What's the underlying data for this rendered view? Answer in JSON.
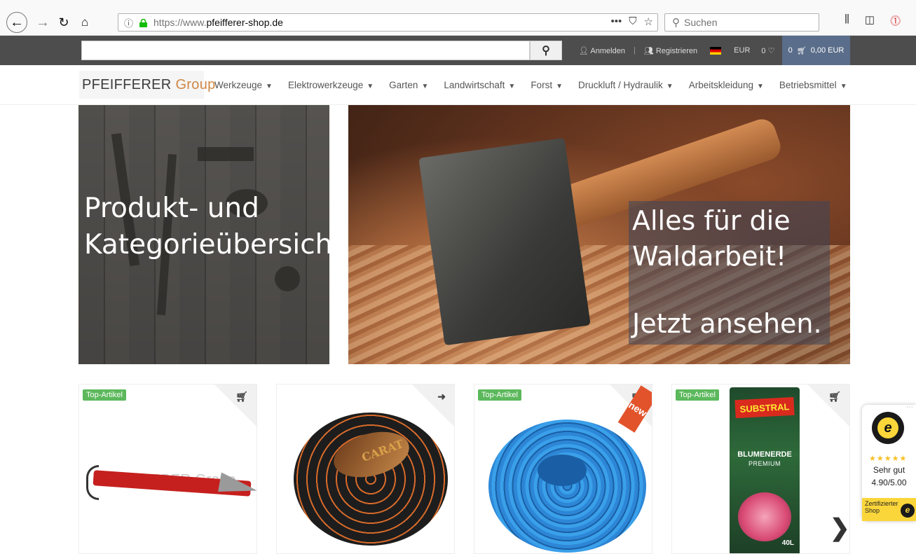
{
  "browser": {
    "url_prefix": "https://www.",
    "url_host": "pfeifferer-shop.de",
    "search_placeholder": "Suchen",
    "url_more": "•••"
  },
  "topbar": {
    "login": "Anmelden",
    "separator": "|",
    "register": "Registrieren",
    "currency": "EUR",
    "wishlist_count": "0",
    "cart_count": "0",
    "cart_total": "0,00 EUR"
  },
  "logo": {
    "part1": "PFEIFFERER",
    "part2": "Group"
  },
  "menu": [
    {
      "label": "Werkzeuge"
    },
    {
      "label": "Elektrowerkzeuge"
    },
    {
      "label": "Garten"
    },
    {
      "label": "Landwirtschaft"
    },
    {
      "label": "Forst"
    },
    {
      "label": "Druckluft / Hydraulik"
    },
    {
      "label": "Arbeitskleidung"
    },
    {
      "label": "Betriebsmittel"
    }
  ],
  "hero": {
    "left_line1": "Produkt- und",
    "left_line2": "Kategorieübersicht",
    "right_line1": "Alles für die",
    "right_line2": "Waldarbeit!",
    "right_cta": "Jetzt ansehen."
  },
  "products": [
    {
      "badge": "Top-Artikel",
      "action_icon": "cart-icon",
      "watermark": "PFEIFFERER Group"
    },
    {
      "badge": "",
      "action_icon": "arrow-right-icon",
      "label_text": "CARAT"
    },
    {
      "badge": "Top-Artikel",
      "action_icon": "cart-icon",
      "ribbon": "new"
    },
    {
      "badge": "Top-Artikel",
      "action_icon": "cart-icon",
      "brand": "SUBSTRAL",
      "title": "BLUMENERDE",
      "subtitle": "PREMIUM",
      "volume": "40L"
    }
  ],
  "trusted_shops": {
    "stars": "★★★★★",
    "rating_label": "Sehr gut",
    "score": "4.90/5.00",
    "cert_line1": "Zertifizierter",
    "cert_line2": "Shop",
    "seal_letter": "e"
  },
  "colors": {
    "topbar_bg": "#4d4d4d",
    "cart_bg": "#5a6d8a",
    "badge_green": "#5cb85c",
    "logo_accent": "#d08745",
    "trusted_yellow": "#fbd63a"
  }
}
